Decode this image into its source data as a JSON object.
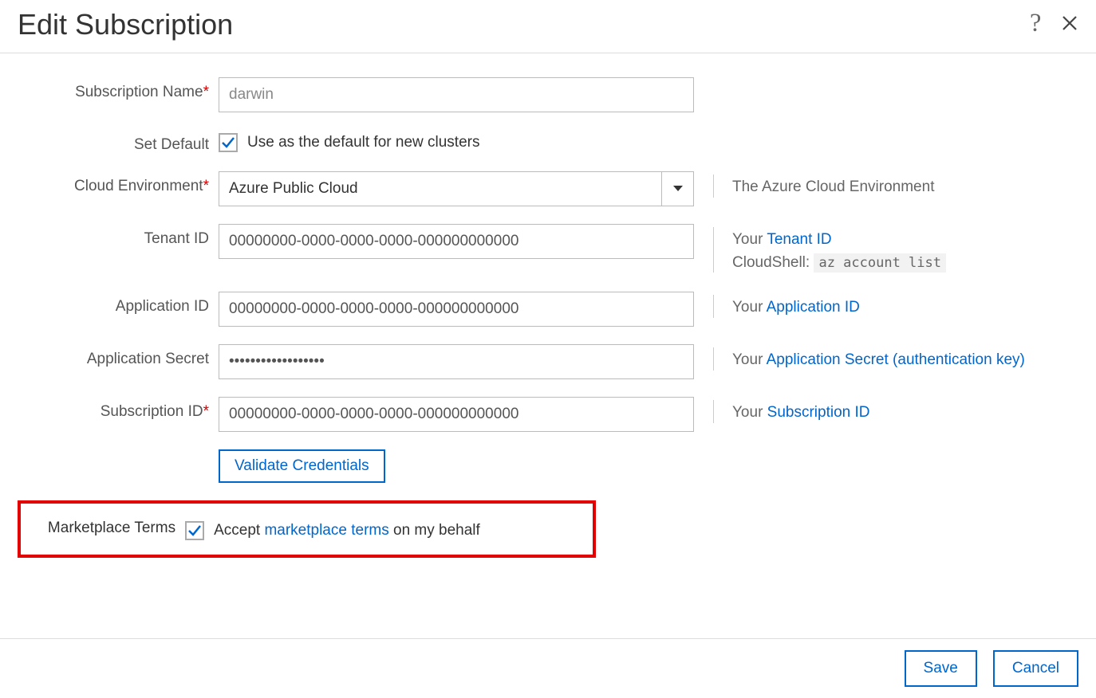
{
  "header": {
    "title": "Edit Subscription"
  },
  "fields": {
    "subscriptionName": {
      "label": "Subscription Name",
      "required": true,
      "value": "darwin"
    },
    "setDefault": {
      "label": "Set Default",
      "checkboxLabel": "Use as the default for new clusters",
      "checked": true
    },
    "cloudEnv": {
      "label": "Cloud Environment",
      "required": true,
      "value": "Azure Public Cloud",
      "help": "The Azure Cloud Environment"
    },
    "tenantId": {
      "label": "Tenant ID",
      "value": "00000000-0000-0000-0000-000000000000",
      "helpPrefix": "Your ",
      "helpLink": "Tenant ID",
      "helpLine2Prefix": "CloudShell: ",
      "helpLine2Code": "az account list"
    },
    "appId": {
      "label": "Application ID",
      "value": "00000000-0000-0000-0000-000000000000",
      "helpPrefix": "Your ",
      "helpLink": "Application ID"
    },
    "appSecret": {
      "label": "Application Secret",
      "value": "••••••••••••••••••",
      "helpPrefix": "Your ",
      "helpLink": "Application Secret (authentication key)"
    },
    "subscriptionId": {
      "label": "Subscription ID",
      "required": true,
      "value": "00000000-0000-0000-0000-000000000000",
      "helpPrefix": "Your ",
      "helpLink": "Subscription ID"
    },
    "validateBtn": "Validate Credentials",
    "marketplace": {
      "label": "Marketplace Terms",
      "checked": true,
      "textBefore": "Accept ",
      "linkText": "marketplace terms",
      "textAfter": " on my behalf"
    }
  },
  "footer": {
    "save": "Save",
    "cancel": "Cancel"
  }
}
